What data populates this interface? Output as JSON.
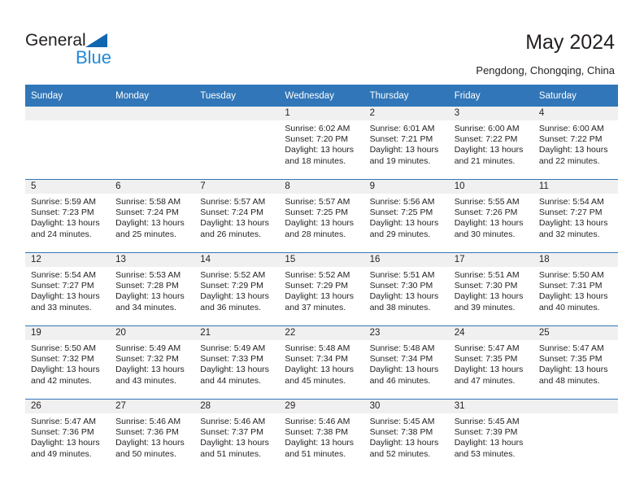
{
  "header": {
    "logo": {
      "text_top": "General",
      "text_bottom": "Blue",
      "triangle_color": "#1166b0",
      "blue_color": "#2389d6"
    },
    "title": "May 2024",
    "subtitle": "Pengdong, Chongqing, China"
  },
  "theme": {
    "header_blue": "#3076b8",
    "daynum_band": "#f0f0f0",
    "text": "#231f20"
  },
  "weekdays": [
    "Sunday",
    "Monday",
    "Tuesday",
    "Wednesday",
    "Thursday",
    "Friday",
    "Saturday"
  ],
  "weeks": [
    [
      {
        "day": "",
        "sunrise": "",
        "sunset": "",
        "daylight1": "",
        "daylight2": ""
      },
      {
        "day": "",
        "sunrise": "",
        "sunset": "",
        "daylight1": "",
        "daylight2": ""
      },
      {
        "day": "",
        "sunrise": "",
        "sunset": "",
        "daylight1": "",
        "daylight2": ""
      },
      {
        "day": "1",
        "sunrise": "Sunrise: 6:02 AM",
        "sunset": "Sunset: 7:20 PM",
        "daylight1": "Daylight: 13 hours",
        "daylight2": "and 18 minutes."
      },
      {
        "day": "2",
        "sunrise": "Sunrise: 6:01 AM",
        "sunset": "Sunset: 7:21 PM",
        "daylight1": "Daylight: 13 hours",
        "daylight2": "and 19 minutes."
      },
      {
        "day": "3",
        "sunrise": "Sunrise: 6:00 AM",
        "sunset": "Sunset: 7:22 PM",
        "daylight1": "Daylight: 13 hours",
        "daylight2": "and 21 minutes."
      },
      {
        "day": "4",
        "sunrise": "Sunrise: 6:00 AM",
        "sunset": "Sunset: 7:22 PM",
        "daylight1": "Daylight: 13 hours",
        "daylight2": "and 22 minutes."
      }
    ],
    [
      {
        "day": "5",
        "sunrise": "Sunrise: 5:59 AM",
        "sunset": "Sunset: 7:23 PM",
        "daylight1": "Daylight: 13 hours",
        "daylight2": "and 24 minutes."
      },
      {
        "day": "6",
        "sunrise": "Sunrise: 5:58 AM",
        "sunset": "Sunset: 7:24 PM",
        "daylight1": "Daylight: 13 hours",
        "daylight2": "and 25 minutes."
      },
      {
        "day": "7",
        "sunrise": "Sunrise: 5:57 AM",
        "sunset": "Sunset: 7:24 PM",
        "daylight1": "Daylight: 13 hours",
        "daylight2": "and 26 minutes."
      },
      {
        "day": "8",
        "sunrise": "Sunrise: 5:57 AM",
        "sunset": "Sunset: 7:25 PM",
        "daylight1": "Daylight: 13 hours",
        "daylight2": "and 28 minutes."
      },
      {
        "day": "9",
        "sunrise": "Sunrise: 5:56 AM",
        "sunset": "Sunset: 7:25 PM",
        "daylight1": "Daylight: 13 hours",
        "daylight2": "and 29 minutes."
      },
      {
        "day": "10",
        "sunrise": "Sunrise: 5:55 AM",
        "sunset": "Sunset: 7:26 PM",
        "daylight1": "Daylight: 13 hours",
        "daylight2": "and 30 minutes."
      },
      {
        "day": "11",
        "sunrise": "Sunrise: 5:54 AM",
        "sunset": "Sunset: 7:27 PM",
        "daylight1": "Daylight: 13 hours",
        "daylight2": "and 32 minutes."
      }
    ],
    [
      {
        "day": "12",
        "sunrise": "Sunrise: 5:54 AM",
        "sunset": "Sunset: 7:27 PM",
        "daylight1": "Daylight: 13 hours",
        "daylight2": "and 33 minutes."
      },
      {
        "day": "13",
        "sunrise": "Sunrise: 5:53 AM",
        "sunset": "Sunset: 7:28 PM",
        "daylight1": "Daylight: 13 hours",
        "daylight2": "and 34 minutes."
      },
      {
        "day": "14",
        "sunrise": "Sunrise: 5:52 AM",
        "sunset": "Sunset: 7:29 PM",
        "daylight1": "Daylight: 13 hours",
        "daylight2": "and 36 minutes."
      },
      {
        "day": "15",
        "sunrise": "Sunrise: 5:52 AM",
        "sunset": "Sunset: 7:29 PM",
        "daylight1": "Daylight: 13 hours",
        "daylight2": "and 37 minutes."
      },
      {
        "day": "16",
        "sunrise": "Sunrise: 5:51 AM",
        "sunset": "Sunset: 7:30 PM",
        "daylight1": "Daylight: 13 hours",
        "daylight2": "and 38 minutes."
      },
      {
        "day": "17",
        "sunrise": "Sunrise: 5:51 AM",
        "sunset": "Sunset: 7:30 PM",
        "daylight1": "Daylight: 13 hours",
        "daylight2": "and 39 minutes."
      },
      {
        "day": "18",
        "sunrise": "Sunrise: 5:50 AM",
        "sunset": "Sunset: 7:31 PM",
        "daylight1": "Daylight: 13 hours",
        "daylight2": "and 40 minutes."
      }
    ],
    [
      {
        "day": "19",
        "sunrise": "Sunrise: 5:50 AM",
        "sunset": "Sunset: 7:32 PM",
        "daylight1": "Daylight: 13 hours",
        "daylight2": "and 42 minutes."
      },
      {
        "day": "20",
        "sunrise": "Sunrise: 5:49 AM",
        "sunset": "Sunset: 7:32 PM",
        "daylight1": "Daylight: 13 hours",
        "daylight2": "and 43 minutes."
      },
      {
        "day": "21",
        "sunrise": "Sunrise: 5:49 AM",
        "sunset": "Sunset: 7:33 PM",
        "daylight1": "Daylight: 13 hours",
        "daylight2": "and 44 minutes."
      },
      {
        "day": "22",
        "sunrise": "Sunrise: 5:48 AM",
        "sunset": "Sunset: 7:34 PM",
        "daylight1": "Daylight: 13 hours",
        "daylight2": "and 45 minutes."
      },
      {
        "day": "23",
        "sunrise": "Sunrise: 5:48 AM",
        "sunset": "Sunset: 7:34 PM",
        "daylight1": "Daylight: 13 hours",
        "daylight2": "and 46 minutes."
      },
      {
        "day": "24",
        "sunrise": "Sunrise: 5:47 AM",
        "sunset": "Sunset: 7:35 PM",
        "daylight1": "Daylight: 13 hours",
        "daylight2": "and 47 minutes."
      },
      {
        "day": "25",
        "sunrise": "Sunrise: 5:47 AM",
        "sunset": "Sunset: 7:35 PM",
        "daylight1": "Daylight: 13 hours",
        "daylight2": "and 48 minutes."
      }
    ],
    [
      {
        "day": "26",
        "sunrise": "Sunrise: 5:47 AM",
        "sunset": "Sunset: 7:36 PM",
        "daylight1": "Daylight: 13 hours",
        "daylight2": "and 49 minutes."
      },
      {
        "day": "27",
        "sunrise": "Sunrise: 5:46 AM",
        "sunset": "Sunset: 7:36 PM",
        "daylight1": "Daylight: 13 hours",
        "daylight2": "and 50 minutes."
      },
      {
        "day": "28",
        "sunrise": "Sunrise: 5:46 AM",
        "sunset": "Sunset: 7:37 PM",
        "daylight1": "Daylight: 13 hours",
        "daylight2": "and 51 minutes."
      },
      {
        "day": "29",
        "sunrise": "Sunrise: 5:46 AM",
        "sunset": "Sunset: 7:38 PM",
        "daylight1": "Daylight: 13 hours",
        "daylight2": "and 51 minutes."
      },
      {
        "day": "30",
        "sunrise": "Sunrise: 5:45 AM",
        "sunset": "Sunset: 7:38 PM",
        "daylight1": "Daylight: 13 hours",
        "daylight2": "and 52 minutes."
      },
      {
        "day": "31",
        "sunrise": "Sunrise: 5:45 AM",
        "sunset": "Sunset: 7:39 PM",
        "daylight1": "Daylight: 13 hours",
        "daylight2": "and 53 minutes."
      },
      {
        "day": "",
        "sunrise": "",
        "sunset": "",
        "daylight1": "",
        "daylight2": ""
      }
    ]
  ]
}
